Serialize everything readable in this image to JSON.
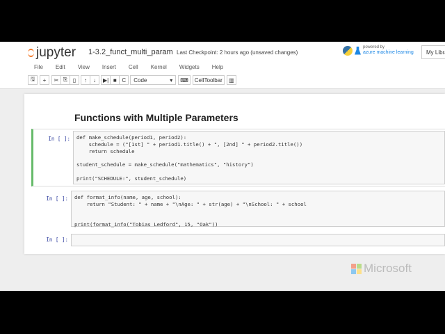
{
  "header": {
    "logo": "jupyter",
    "notebook_name": "1-3.2_funct_multi_param",
    "checkpoint": "Last Checkpoint: 2 hours ago (unsaved changes)",
    "powered_by": "powered by",
    "azure": "azure machine learning",
    "my_library": "My Libraries"
  },
  "menu": [
    "File",
    "Edit",
    "View",
    "Insert",
    "Cell",
    "Kernel",
    "Widgets",
    "Help"
  ],
  "toolbar": {
    "cell_type": "Code",
    "celltoolbar": "CellToolbar"
  },
  "heading": "Functions with Multiple Parameters",
  "cells": [
    {
      "prompt": "In [ ]:",
      "code": "def make_schedule(period1, period2):\n    schedule = (\"[1st] \" + period1.title() + \", [2nd] \" + period2.title())\n    return schedule\n\nstudent_schedule = make_schedule(\"mathematics\", \"history\")\n\nprint(\"SCHEDULE:\", student_schedule)"
    },
    {
      "prompt": "In [ ]:",
      "code": "def format_info(name, age, school):\n    return \"Student: \" + name + \"\\nAge: \" + str(age) + \"\\nSchool: \" + school\n\n\nprint(format_info(\"Tobias Ledford\", 15, \"Oak\"))"
    },
    {
      "prompt": "In [ ]:",
      "code": ""
    }
  ],
  "watermark": "Microsoft",
  "colors": {
    "accent": "#f37726",
    "selected": "#66bb6a"
  }
}
